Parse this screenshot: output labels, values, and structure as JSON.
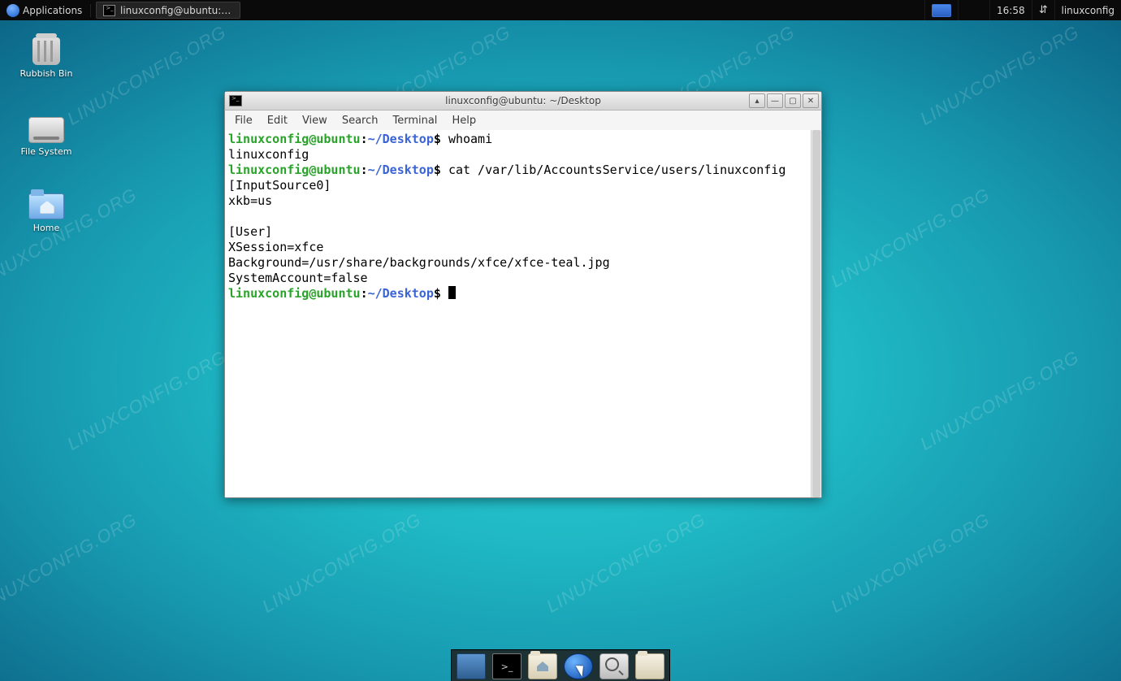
{
  "panel": {
    "applications_label": "Applications",
    "taskbar_window_title": "linuxconfig@ubuntu: ~/...",
    "clock": "16:58",
    "username": "linuxconfig"
  },
  "desktop_icons": {
    "trash": "Rubbish Bin",
    "filesystem": "File System",
    "home": "Home"
  },
  "window": {
    "title": "linuxconfig@ubuntu: ~/Desktop",
    "menus": [
      "File",
      "Edit",
      "View",
      "Search",
      "Terminal",
      "Help"
    ]
  },
  "prompt": {
    "user_host": "linuxconfig@ubuntu",
    "path": "~/Desktop",
    "dollar": "$"
  },
  "terminal": {
    "cmd1": "whoami",
    "out1": "linuxconfig",
    "cmd2": "cat /var/lib/AccountsService/users/linuxconfig",
    "out2_l1": "[InputSource0]",
    "out2_l2": "xkb=us",
    "out2_l3": "",
    "out2_l4": "[User]",
    "out2_l5": "XSession=xfce",
    "out2_l6": "Background=/usr/share/backgrounds/xfce/xfce-teal.jpg",
    "out2_l7": "SystemAccount=false"
  },
  "watermark": "LINUXCONFIG.ORG"
}
